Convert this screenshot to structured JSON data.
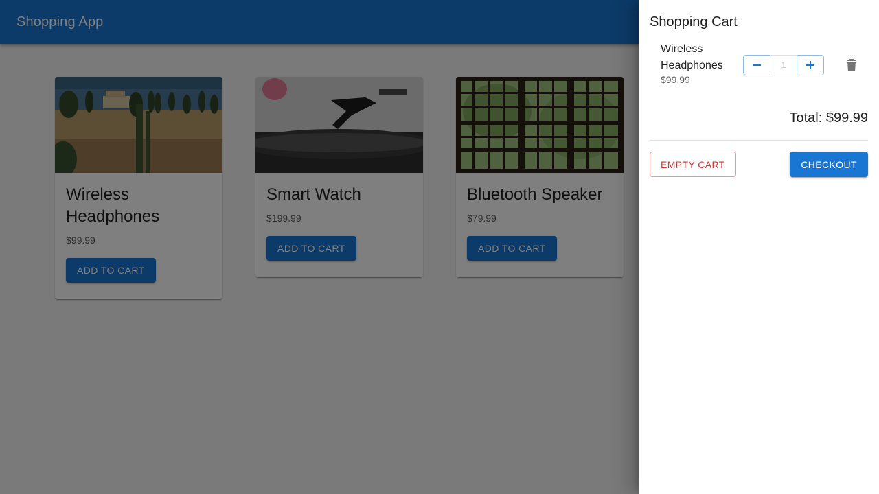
{
  "app": {
    "title": "Shopping App"
  },
  "products": [
    {
      "name": "Wireless Headphones",
      "price": "$99.99",
      "button": "ADD TO CART"
    },
    {
      "name": "Smart Watch",
      "price": "$199.99",
      "button": "ADD TO CART"
    },
    {
      "name": "Bluetooth Speaker",
      "price": "$79.99",
      "button": "ADD TO CART"
    }
  ],
  "cart": {
    "title": "Shopping Cart",
    "items": [
      {
        "name": "Wireless Headphones",
        "price": "$99.99",
        "quantity": "1"
      }
    ],
    "total": "Total: $99.99",
    "empty_label": "EMPTY CART",
    "checkout_label": "CHECKOUT"
  },
  "icons": {
    "decrement": "minus-icon",
    "increment": "plus-icon",
    "remove": "trash-icon"
  },
  "colors": {
    "primary": "#1976d2",
    "error": "#d32f2f"
  }
}
